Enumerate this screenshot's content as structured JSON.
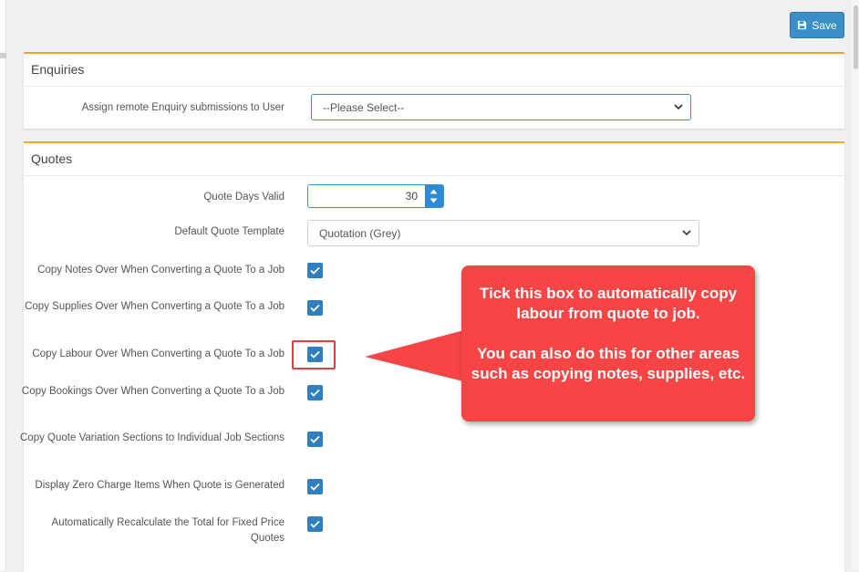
{
  "toolbar": {
    "save_label": "Save",
    "save_icon": "floppy-disk-icon"
  },
  "enquiries": {
    "title": "Enquiries",
    "assign_label": "Assign remote Enquiry submissions to User",
    "assign_value": "--Please Select--"
  },
  "quotes": {
    "title": "Quotes",
    "days_valid_label": "Quote Days Valid",
    "days_valid_value": "30",
    "template_label": "Default Quote Template",
    "template_value": "Quotation (Grey)",
    "options": [
      {
        "label": "Copy Notes Over When Converting a Quote To a Job",
        "checked": true
      },
      {
        "label": "Copy Supplies Over When Converting a Quote To a Job",
        "checked": true
      },
      {
        "label": "Copy Labour Over When Converting a Quote To a Job",
        "checked": true
      },
      {
        "label": "Copy Bookings Over When Converting a Quote To a Job",
        "checked": true
      },
      {
        "label": "Copy Quote Variation Sections to Individual Job Sections",
        "checked": true
      },
      {
        "label": "Display Zero Charge Items When Quote is Generated",
        "checked": true
      },
      {
        "label": "Automatically Recalculate the Total for Fixed Price Quotes",
        "checked": true
      }
    ]
  },
  "callout": {
    "line1": "Tick this box to automatically copy labour from quote to job.",
    "line2": "You can also do this for other areas such as copying notes, supplies, etc."
  },
  "colors": {
    "accent": "#f5a623",
    "primary": "#3b8fc9",
    "callout": "#f74545",
    "highlight": "#e0413f"
  }
}
